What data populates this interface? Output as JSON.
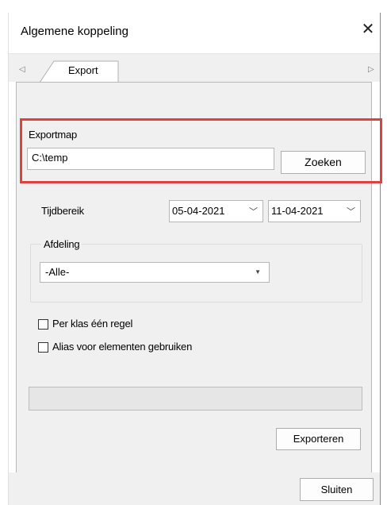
{
  "window": {
    "title": "Algemene koppeling",
    "close_glyph": "✕"
  },
  "tabs": {
    "left_arrow": "◁",
    "right_arrow": "▷",
    "active_label": "Export"
  },
  "exportmap": {
    "label": "Exportmap",
    "value": "C:\\temp",
    "button": "Zoeken"
  },
  "tijdbereik": {
    "label": "Tijdbereik",
    "from": "05-04-2021",
    "to": "11-04-2021"
  },
  "afdeling": {
    "label": "Afdeling",
    "selected": "-Alle-"
  },
  "options": [
    {
      "label": "Per klas één regel",
      "checked": false
    },
    {
      "label": "Alias voor elementen gebruiken",
      "checked": false
    }
  ],
  "actions": {
    "export_button": "Exporteren",
    "close_button": "Sluiten"
  },
  "colors": {
    "highlight": "#e0403e",
    "panel": "#f0f0f0"
  }
}
